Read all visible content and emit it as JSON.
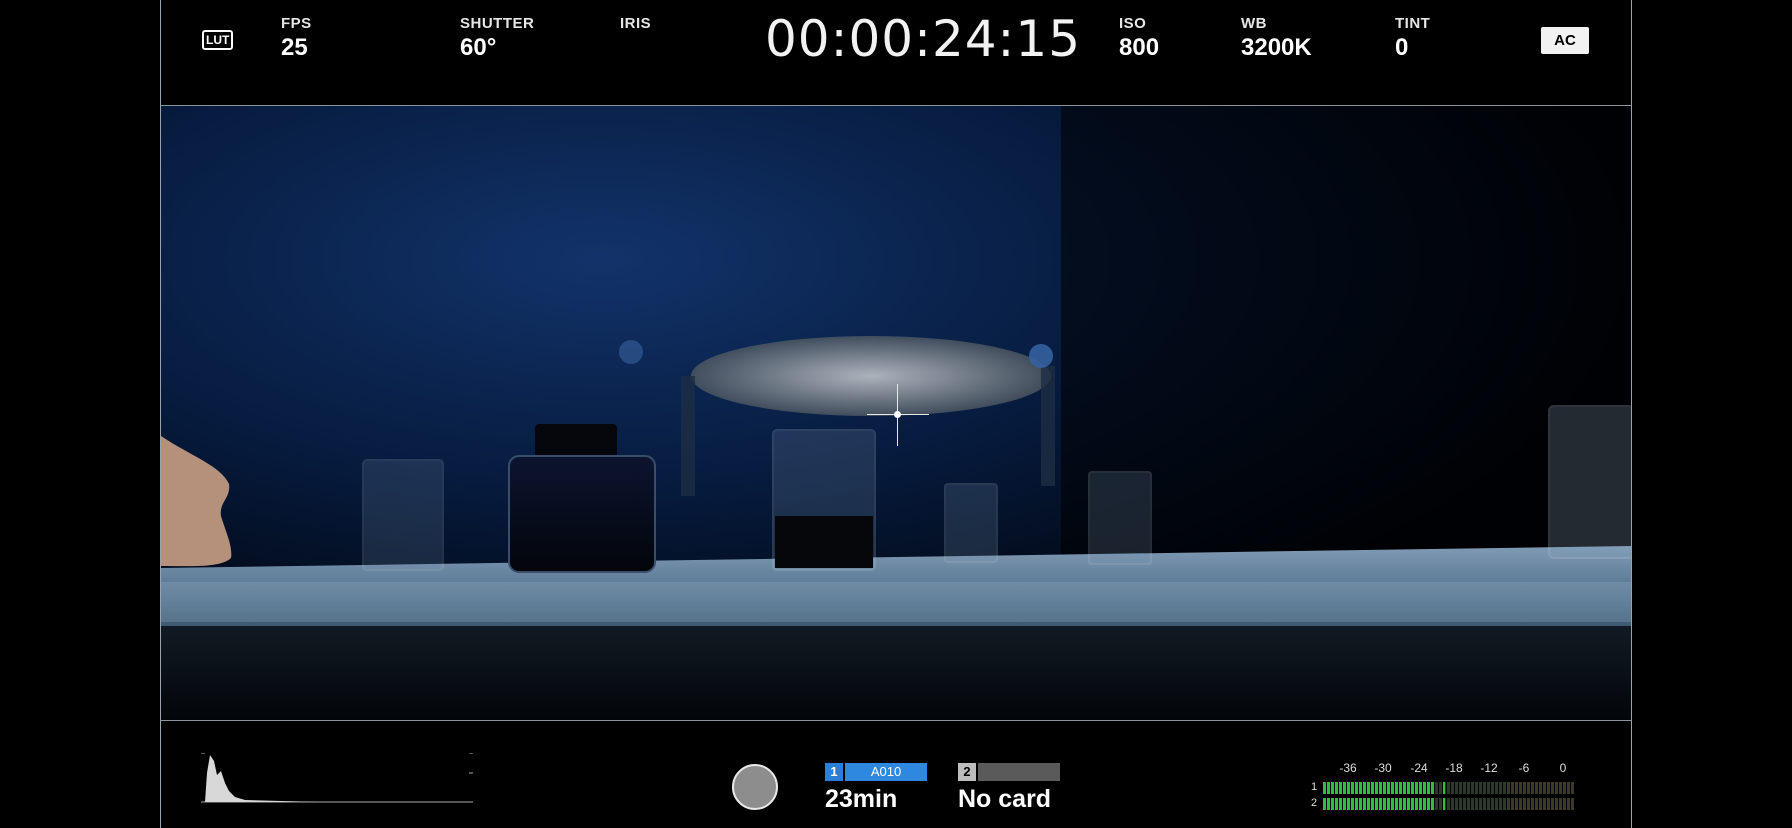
{
  "top": {
    "lut_label": "LUT",
    "fps": {
      "label": "FPS",
      "value": "25"
    },
    "shutter": {
      "label": "SHUTTER",
      "value": "60°"
    },
    "iris": {
      "label": "IRIS",
      "value": ""
    },
    "timecode": "00:00:24:15",
    "iso": {
      "label": "ISO",
      "value": "800"
    },
    "wb": {
      "label": "WB",
      "value": "3200K"
    },
    "tint": {
      "label": "TINT",
      "value": "0"
    },
    "ac_button": "AC"
  },
  "bottom": {
    "card1": {
      "slot": "1",
      "clip": "A010",
      "remaining": "23min",
      "accent": "#2f88e0"
    },
    "card2": {
      "slot": "2",
      "clip": "",
      "remaining": "No card"
    },
    "audio_meter": {
      "scale": [
        "-36",
        "-30",
        "-24",
        "-18",
        "-12",
        "-6",
        "0"
      ],
      "channels": [
        {
          "label": "1",
          "level_db": -24
        },
        {
          "label": "2",
          "level_db": -24
        }
      ],
      "colors": {
        "active": "#29c23a",
        "inactive": "#2a3a2a"
      }
    }
  }
}
